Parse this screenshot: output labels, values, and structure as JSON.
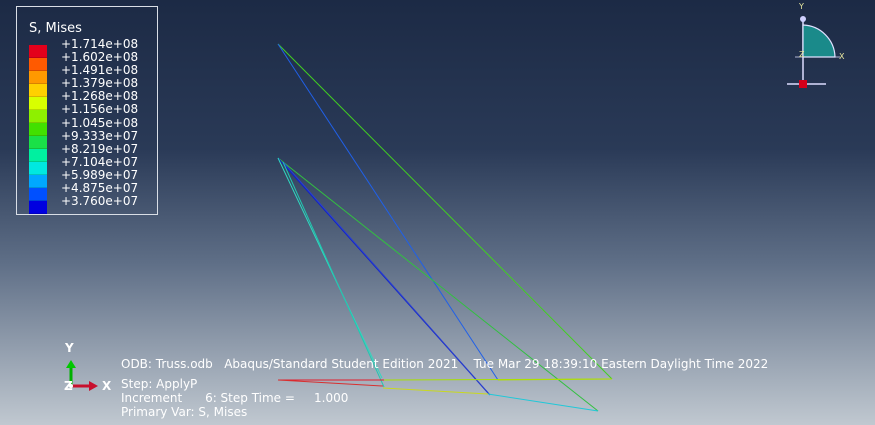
{
  "legend": {
    "title": "S, Mises",
    "colors": [
      "#e3001b",
      "#ff5a00",
      "#ff9900",
      "#ffd000",
      "#d8ff00",
      "#8ef000",
      "#42e000",
      "#1ae048",
      "#00f0a0",
      "#00e8e0",
      "#00a8ff",
      "#0050ff",
      "#0000e0"
    ],
    "labels": [
      "+1.714e+08",
      "+1.602e+08",
      "+1.491e+08",
      "+1.379e+08",
      "+1.268e+08",
      "+1.156e+08",
      "+1.045e+08",
      "+9.333e+07",
      "+8.219e+07",
      "+7.104e+07",
      "+5.989e+07",
      "+4.875e+07",
      "+3.760e+07"
    ]
  },
  "info": {
    "odb_line": "ODB: Truss.odb   Abaqus/Standard Student Edition 2021    Tue Mar 29 18:39:10 Eastern Daylight Time 2022",
    "step_line": "Step: ApplyP",
    "increment_line": "Increment      6: Step Time =     1.000",
    "primary_var_line": "Primary Var: S, Mises"
  },
  "triad": {
    "y_label": "Y",
    "x_label": "X",
    "z_label": "Z"
  },
  "view_cube": {
    "y_label": "Y",
    "x_label": "X",
    "z_label": "Z"
  },
  "colors": {
    "viewport_top": "#1c2a45",
    "viewport_bottom": "#c0c8d0",
    "x_axis": "#c8102e",
    "y_axis": "#00b000"
  }
}
